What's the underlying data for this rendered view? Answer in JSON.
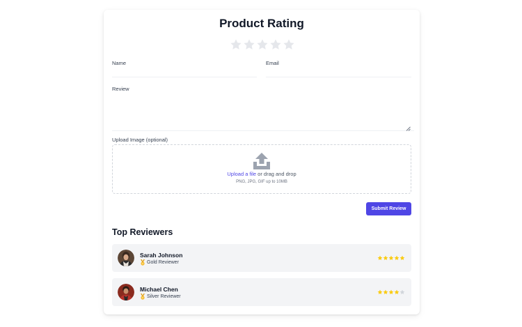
{
  "form": {
    "title": "Product Rating",
    "rating": {
      "value": 0,
      "max": 5
    },
    "name_label": "Name",
    "email_label": "Email",
    "review_label": "Review",
    "upload_label": "Upload Image (optional)",
    "upload_link": "Upload a file",
    "upload_text": " or drag and drop",
    "upload_hint": "PNG, JPG, GIF up to 10MB",
    "submit_label": "Submit Review"
  },
  "reviewers": {
    "title": "Top Reviewers",
    "items": [
      {
        "name": "Sarah Johnson",
        "badge": "Gold Reviewer",
        "rating": 5,
        "max": 5
      },
      {
        "name": "Michael Chen",
        "badge": "Silver Reviewer",
        "rating": 4,
        "max": 5
      }
    ]
  },
  "colors": {
    "accent": "#4f46e5",
    "star_filled": "#facc15",
    "star_empty": "#e5e7eb",
    "row_bg": "#f3f4f6",
    "icon_gray": "#9ca3af"
  },
  "icons": [
    "star-icon",
    "upload-icon",
    "resize-grip-icon",
    "medal-icon"
  ]
}
